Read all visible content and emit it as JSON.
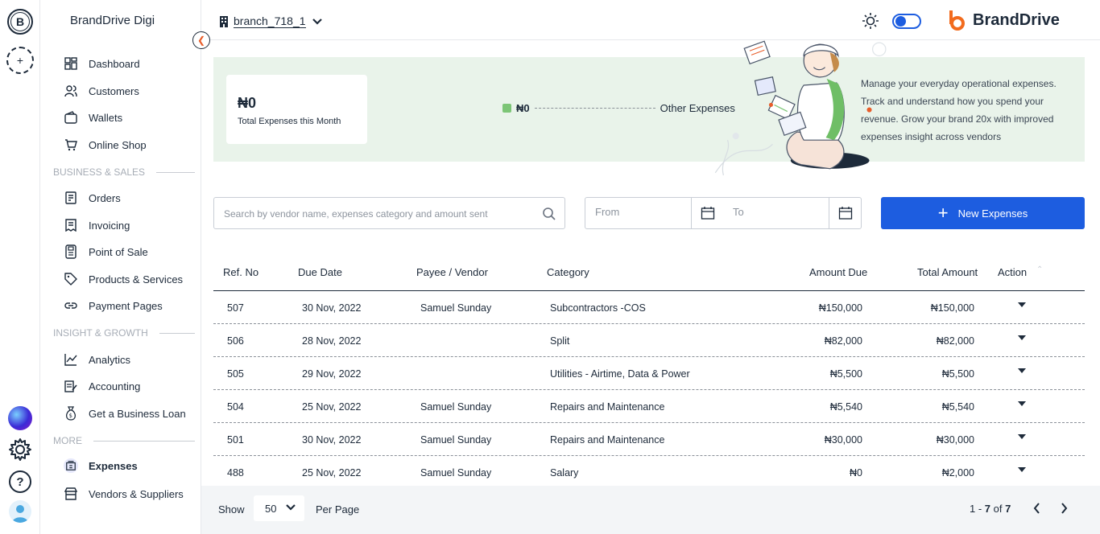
{
  "rail": {
    "org_initial": "B",
    "add_label": "+",
    "help_label": "?"
  },
  "sidebar": {
    "brand": "BrandDrive Digi",
    "collapse_icon": "chevron-left-icon",
    "items_top": [
      {
        "label": "Dashboard",
        "icon": "dashboard-icon"
      },
      {
        "label": "Customers",
        "icon": "users-icon"
      },
      {
        "label": "Wallets",
        "icon": "wallet-icon"
      },
      {
        "label": "Online Shop",
        "icon": "cart-icon"
      }
    ],
    "section_business": "BUSINESS & SALES",
    "items_business": [
      {
        "label": "Orders",
        "icon": "orders-icon"
      },
      {
        "label": "Invoicing",
        "icon": "invoice-icon"
      },
      {
        "label": "Point of Sale",
        "icon": "pos-icon"
      },
      {
        "label": "Products & Services",
        "icon": "tag-icon"
      },
      {
        "label": "Payment Pages",
        "icon": "link-icon"
      }
    ],
    "section_insight": "INSIGHT & GROWTH",
    "items_insight": [
      {
        "label": "Analytics",
        "icon": "analytics-icon"
      },
      {
        "label": "Accounting",
        "icon": "accounting-icon"
      },
      {
        "label": "Get a Business Loan",
        "icon": "loan-icon"
      }
    ],
    "section_more": "MORE",
    "items_more": [
      {
        "label": "Expenses",
        "icon": "expenses-icon",
        "active": true
      },
      {
        "label": "Vendors & Suppliers",
        "icon": "store-icon"
      }
    ]
  },
  "topbar": {
    "branch": "branch_718_1",
    "brand_logo": "BrandDrive"
  },
  "banner": {
    "total_amount": "₦0",
    "total_label": "Total Expenses this Month",
    "legend_value": "₦0",
    "legend_label": "Other Expenses",
    "blurb": "Manage your everyday operational expenses. Track and understand how you spend your revenue. Grow your brand 20x with improved expenses insight across vendors"
  },
  "search": {
    "placeholder": "Search by vendor name, expenses category and amount sent"
  },
  "dates": {
    "from_placeholder": "From",
    "to_placeholder": "To"
  },
  "new_button": {
    "label": "New Expenses"
  },
  "table": {
    "headers": [
      "Ref. No",
      "Due Date",
      "Payee / Vendor",
      "Category",
      "Amount Due",
      "Total Amount",
      "Action"
    ],
    "rows": [
      {
        "ref": "507",
        "date": "30 Nov, 2022",
        "payee": "Samuel Sunday",
        "category": "Subcontractors -COS",
        "due": "₦150,000",
        "total": "₦150,000"
      },
      {
        "ref": "506",
        "date": "28 Nov, 2022",
        "payee": "",
        "category": "Split",
        "due": "₦82,000",
        "total": "₦82,000"
      },
      {
        "ref": "505",
        "date": "29 Nov, 2022",
        "payee": "",
        "category": "Utilities - Airtime, Data & Power",
        "due": "₦5,500",
        "total": "₦5,500"
      },
      {
        "ref": "504",
        "date": "25 Nov, 2022",
        "payee": "Samuel Sunday",
        "category": "Repairs and Maintenance",
        "due": "₦5,540",
        "total": "₦5,540"
      },
      {
        "ref": "501",
        "date": "30 Nov, 2022",
        "payee": "Samuel Sunday",
        "category": "Repairs and Maintenance",
        "due": "₦30,000",
        "total": "₦30,000"
      },
      {
        "ref": "488",
        "date": "25 Nov, 2022",
        "payee": "Samuel Sunday",
        "category": "Salary",
        "due": "₦0",
        "total": "₦2,000"
      }
    ]
  },
  "footer": {
    "show_label": "Show",
    "per_page_value": "50",
    "per_page_label": "Per Page",
    "range_start": "1 - ",
    "range_end": "7",
    "range_of": " of ",
    "range_total": "7"
  }
}
